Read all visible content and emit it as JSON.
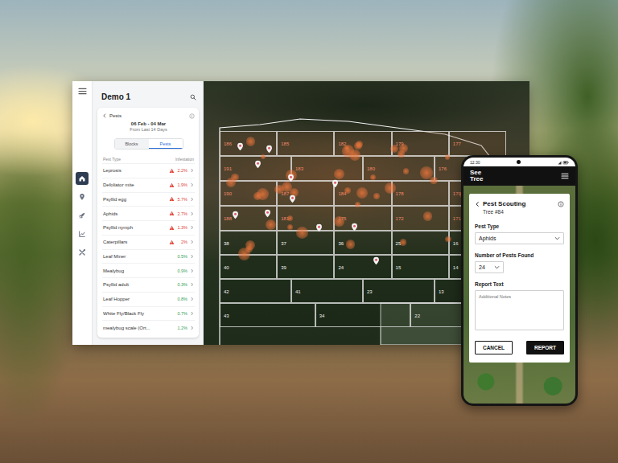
{
  "desktop": {
    "rail": {
      "items": [
        {
          "kind": "home",
          "selected": true
        },
        {
          "kind": "pin",
          "selected": false
        },
        {
          "kind": "rocket",
          "selected": false
        },
        {
          "kind": "chart",
          "selected": false
        },
        {
          "kind": "tools",
          "selected": false
        }
      ]
    },
    "panel": {
      "title": "Demo 1",
      "card": {
        "title": "Pests",
        "date_range": "06 Feb - 04 Mar",
        "period": "From Last 14 Days",
        "tabs": [
          {
            "label": "Blocks",
            "selected": false
          },
          {
            "label": "Pests",
            "selected": true
          }
        ],
        "columns": [
          "Pest Type",
          "Infestation"
        ],
        "rows": [
          {
            "name": "Leprosis",
            "value": "2.2%",
            "alert": true,
            "color": "#e0473b"
          },
          {
            "name": "Defoliator mite",
            "value": "1.9%",
            "alert": true,
            "color": "#e0473b"
          },
          {
            "name": "Psyllid egg",
            "value": "5.7%",
            "alert": true,
            "color": "#e0473b"
          },
          {
            "name": "Aphids",
            "value": "2.7%",
            "alert": true,
            "color": "#e0473b"
          },
          {
            "name": "Psyllid nymph",
            "value": "1.3%",
            "alert": true,
            "color": "#e0473b"
          },
          {
            "name": "Caterpillars",
            "value": "2%",
            "alert": true,
            "color": "#e0473b"
          },
          {
            "name": "Leaf Miner",
            "value": "0.5%",
            "alert": false,
            "color": "#3a9f58"
          },
          {
            "name": "Mealybug",
            "value": "0.9%",
            "alert": false,
            "color": "#3a9f58"
          },
          {
            "name": "Psyllid adult",
            "value": "0.3%",
            "alert": false,
            "color": "#3a9f58"
          },
          {
            "name": "Leaf Hopper",
            "value": "0.8%",
            "alert": false,
            "color": "#3a9f58"
          },
          {
            "name": "White Fly/Black Fly",
            "value": "0.7%",
            "alert": false,
            "color": "#3a9f58"
          },
          {
            "name": "mealybug scale (Ort...",
            "value": "1.2%",
            "alert": false,
            "color": "#3a9f58"
          }
        ]
      }
    },
    "map": {
      "plot_rows": [
        {
          "infested": true,
          "labels": [
            "186",
            "185",
            "182",
            "179",
            "177"
          ]
        },
        {
          "infested": true,
          "labels": [
            "191",
            "183",
            "180",
            "176"
          ]
        },
        {
          "infested": true,
          "labels": [
            "190",
            "187",
            "184",
            "178",
            "170"
          ]
        },
        {
          "infested": true,
          "labels": [
            "188",
            "181",
            "175",
            "172",
            "171"
          ]
        },
        {
          "infested": false,
          "labels": [
            "38",
            "37",
            "36",
            "25",
            "16"
          ]
        },
        {
          "infested": false,
          "labels": [
            "40",
            "39",
            "24",
            "15",
            "14"
          ]
        },
        {
          "infested": false,
          "labels": [
            "42",
            "41",
            "23",
            "13"
          ]
        },
        {
          "infested": false,
          "labels": [
            "43",
            "34",
            "22"
          ]
        }
      ]
    }
  },
  "phone": {
    "time": "12:30",
    "logo": [
      "See",
      "Tree"
    ],
    "title": "Pest Scouting",
    "subtitle": "Tree #84",
    "fields": [
      {
        "kind": "select",
        "label": "Pest Type",
        "value": "Aphids"
      },
      {
        "kind": "number",
        "label": "Number of Pests Found",
        "value": "24"
      },
      {
        "kind": "textarea",
        "label": "Report Text",
        "placeholder": "Additional Notes"
      }
    ],
    "buttons": [
      {
        "label": "CANCEL",
        "kind": "secondary"
      },
      {
        "label": "REPORT",
        "kind": "primary"
      }
    ]
  }
}
